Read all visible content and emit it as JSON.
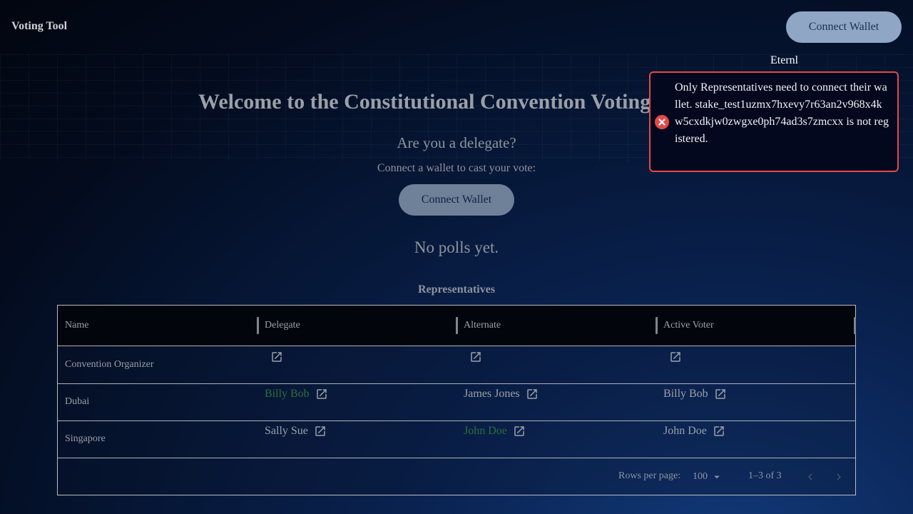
{
  "app": {
    "title": "Voting Tool"
  },
  "header": {
    "connect_label": "Connect Wallet",
    "wallet_name": "Eternl"
  },
  "main": {
    "heading": "Welcome to the Constitutional Convention Voting Tool",
    "question": "Are you a delegate?",
    "connect_prompt": "Connect a wallet to cast your vote:",
    "connect_label": "Connect Wallet",
    "no_polls": "No polls yet."
  },
  "representatives": {
    "title": "Representatives",
    "columns": [
      "Name",
      "Delegate",
      "Alternate",
      "Active Voter"
    ],
    "rows": [
      {
        "name": "Convention Organizer",
        "delegate": "",
        "alternate": "",
        "active_voter": ""
      },
      {
        "name": "Dubai",
        "delegate": "Billy Bob",
        "alternate": "James Jones",
        "active_voter": "Billy Bob"
      },
      {
        "name": "Singapore",
        "delegate": "Sally Sue",
        "alternate": "John Doe",
        "active_voter": "John Doe"
      }
    ],
    "highlight_color": "#2f6d3a",
    "rows_per_page_label": "Rows per page:",
    "rows_per_page_value": "100",
    "pagination_range": "1–3 of 3"
  },
  "toast": {
    "message": "Only Representatives need to connect their wallet. stake_test1uzmx7hxevy7r63an2v968x4kw5cxdkjw0zwgxe0ph74ad3s7zmcxx is not registered.",
    "type": "error",
    "icon": "error-circle-icon",
    "border_color": "#e24a48"
  }
}
